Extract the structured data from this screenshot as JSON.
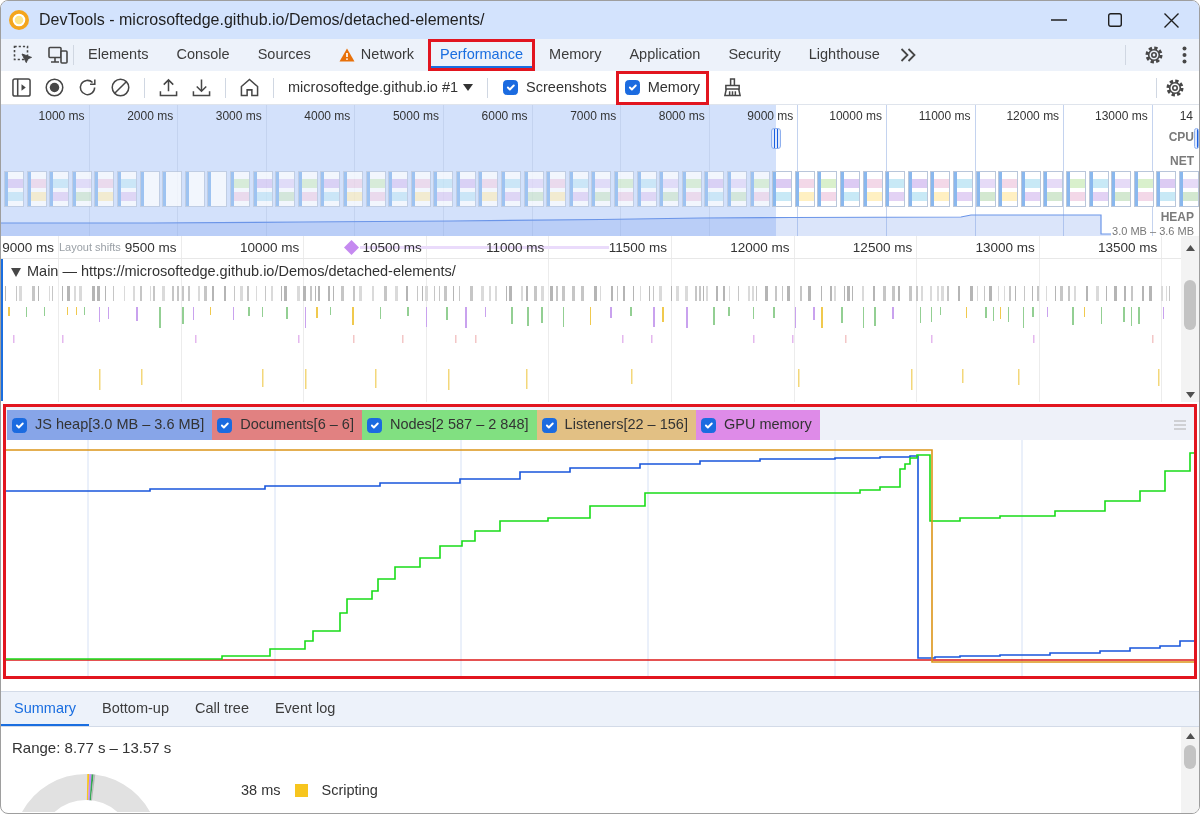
{
  "window": {
    "title": "DevTools - microsoftedge.github.io/Demos/detached-elements/"
  },
  "tabs": [
    {
      "label": "Elements",
      "selected": false,
      "warning": false,
      "highlighted": false
    },
    {
      "label": "Console",
      "selected": false,
      "warning": false,
      "highlighted": false
    },
    {
      "label": "Sources",
      "selected": false,
      "warning": false,
      "highlighted": false
    },
    {
      "label": "Network",
      "selected": false,
      "warning": true,
      "highlighted": false
    },
    {
      "label": "Performance",
      "selected": true,
      "warning": false,
      "highlighted": true
    },
    {
      "label": "Memory",
      "selected": false,
      "warning": false,
      "highlighted": false
    },
    {
      "label": "Application",
      "selected": false,
      "warning": false,
      "highlighted": false
    },
    {
      "label": "Security",
      "selected": false,
      "warning": false,
      "highlighted": false
    },
    {
      "label": "Lighthouse",
      "selected": false,
      "warning": false,
      "highlighted": false
    }
  ],
  "toolbar": {
    "target": "microsoftedge.github.io #1",
    "options": [
      {
        "label": "Screenshots",
        "checked": true,
        "highlighted": false
      },
      {
        "label": "Memory",
        "checked": true,
        "highlighted": true
      }
    ]
  },
  "overview": {
    "ticks": [
      "1000 ms",
      "2000 ms",
      "3000 ms",
      "4000 ms",
      "5000 ms",
      "6000 ms",
      "7000 ms",
      "8000 ms",
      "9000 ms",
      "10000 ms",
      "11000 ms",
      "12000 ms",
      "13000 ms",
      "14"
    ],
    "tracks": [
      "CPU",
      "NET",
      "HEAP"
    ],
    "heap_range": "3.0 MB – 3.6 MB"
  },
  "timeline": {
    "ticks": [
      "9000 ms",
      "9500 ms",
      "10000 ms",
      "10500 ms",
      "11000 ms",
      "11500 ms",
      "12000 ms",
      "12500 ms",
      "13000 ms",
      "13500 ms"
    ],
    "layout_shifts": "Layout shifts",
    "main_track": {
      "title": "Main — https://microsoftedge.github.io/Demos/detached-elements/",
      "expanded": true
    }
  },
  "counters": {
    "highlighted": true,
    "items": [
      {
        "label": "JS heap[3.0 MB – 3.6 MB]",
        "checked": true,
        "color": "#87a5e8"
      },
      {
        "label": "Documents[6 – 6]",
        "checked": true,
        "color": "#e18181"
      },
      {
        "label": "Nodes[2 587 – 2 848]",
        "checked": true,
        "color": "#81e081"
      },
      {
        "label": "Listeners[22 – 156]",
        "checked": true,
        "color": "#e2c084"
      },
      {
        "label": "GPU memory",
        "checked": true,
        "color": "#de8be8"
      }
    ]
  },
  "details": {
    "tabs": [
      {
        "label": "Summary",
        "selected": true
      },
      {
        "label": "Bottom-up",
        "selected": false
      },
      {
        "label": "Call tree",
        "selected": false
      },
      {
        "label": "Event log",
        "selected": false
      }
    ],
    "range": "Range: 8.77 s – 13.57 s",
    "legend": [
      {
        "value": "38 ms",
        "label": "Scripting",
        "color": "#f7c51e"
      }
    ]
  }
}
